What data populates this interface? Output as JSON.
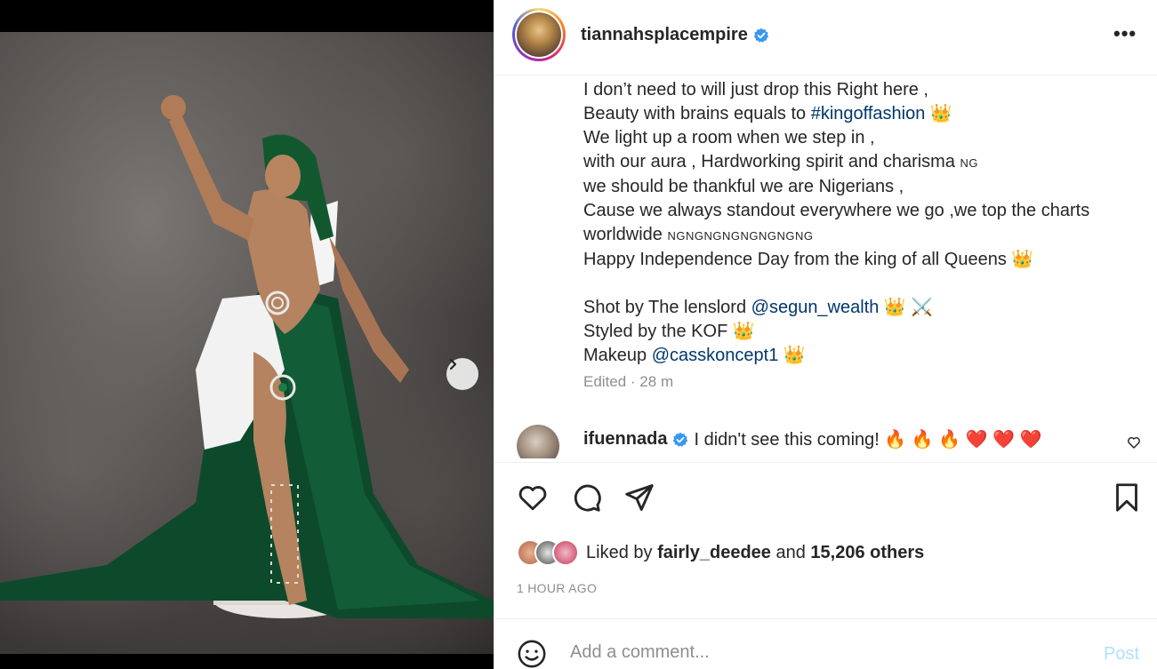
{
  "post": {
    "username": "tiannahsplacempire",
    "more_label": "•••",
    "carousel": {
      "current_slide": 1,
      "total_slides": 3
    }
  },
  "caption": {
    "lines": [
      {
        "text": "I don’t need to will just drop this Right here ,"
      },
      {
        "pre": "Beauty with brains equals to ",
        "link": "#kingoffashion",
        "post": " 👑"
      },
      {
        "text": "We light up a room when we step in ,"
      },
      {
        "pre": "with our aura , Hardworking spirit and charisma ",
        "flag": "NG"
      },
      {
        "text": "we should be thankful we are Nigerians ,"
      },
      {
        "text": "Cause we always standout everywhere we go ,we top the charts"
      },
      {
        "pre": "worldwide ",
        "flag": "NGNGNGNGNGNGNGNG"
      },
      {
        "text": "Happy Independence Day from the king of all Queens 👑"
      },
      {
        "blank": true
      },
      {
        "pre": "Shot by The lenslord ",
        "link": "@segun_wealth",
        "post": " 👑 ⚔️"
      },
      {
        "pre": "Styled by the KOF",
        "post": " 👑"
      },
      {
        "pre": "Makeup ",
        "link": "@casskoncept1",
        "post": " 👑"
      }
    ],
    "edited_label": "Edited · 28 m"
  },
  "comment": {
    "username": "ifuennada",
    "text": "I didn't see this coming! 🔥 🔥 🔥 ❤️ ❤️ ❤️"
  },
  "likes": {
    "prefix": "Liked by ",
    "user": "fairly_deedee",
    "middle": " and ",
    "count": "15,206 others"
  },
  "timestamp": "1 HOUR AGO",
  "comment_box": {
    "placeholder": "Add a comment...",
    "post_label": "Post"
  },
  "colors": {
    "link": "#00376b",
    "verified": "#3897f0",
    "muted": "#8e8e8e",
    "post_disabled": "#b2dffc",
    "flag_green": "#0b6b3a"
  },
  "icons": [
    "verified-icon",
    "more-icon",
    "chevron-right-icon",
    "heart-icon",
    "comment-icon",
    "share-icon",
    "bookmark-icon",
    "smiley-icon"
  ]
}
